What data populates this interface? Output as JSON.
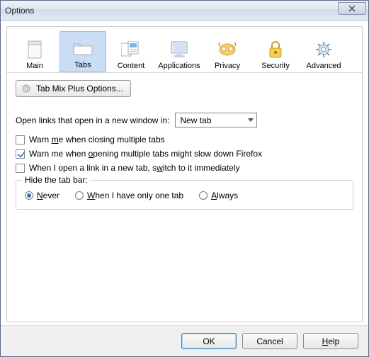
{
  "window": {
    "title": "Options"
  },
  "tabs": {
    "main": "Main",
    "tabs": "Tabs",
    "content": "Content",
    "applications": "Applications",
    "privacy": "Privacy",
    "security": "Security",
    "advanced": "Advanced"
  },
  "tmp_button": "Tab Mix Plus Options...",
  "open_links_label": "Open links that open in a new window in:",
  "open_links_value": "New tab",
  "checkboxes": {
    "warn_close": {
      "pre": "Warn ",
      "u": "m",
      "post": "e when closing multiple tabs",
      "checked": false
    },
    "warn_open": {
      "pre": "Warn me when ",
      "u": "o",
      "post": "pening multiple tabs might slow down Firefox",
      "checked": true
    },
    "switch": {
      "pre": "When I open a link in a new tab, s",
      "u": "w",
      "post": "itch to it immediately",
      "checked": false
    }
  },
  "hide_tabbar": {
    "legend": "Hide the tab bar:",
    "never": {
      "u": "N",
      "post": "ever",
      "checked": true
    },
    "onlyone": {
      "u": "W",
      "post": "hen I have only one tab",
      "checked": false
    },
    "always": {
      "u": "A",
      "post": "lways",
      "checked": false
    }
  },
  "footer": {
    "ok": "OK",
    "cancel": "Cancel",
    "help_u": "H",
    "help_post": "elp"
  }
}
